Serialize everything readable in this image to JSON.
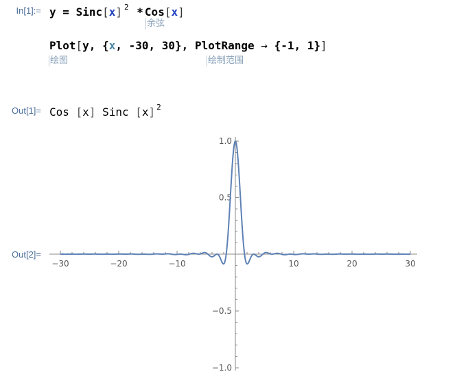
{
  "cells": {
    "in1_label": "In[1]:=",
    "line1": {
      "y": "y",
      "eq": "=",
      "sinc": "Sinc",
      "x1": "x",
      "pow": "2",
      "star": "*",
      "cos": "Cos",
      "x2": "x"
    },
    "hint_cos": "余弦",
    "line2": {
      "plot": "Plot",
      "open": "[",
      "y": "y, {",
      "x": "x",
      "range": ", -30, 30}, ",
      "plotrange": "PlotRange",
      "arrow": "→",
      "pr_value": "{-1, 1}",
      "close": "]"
    },
    "hint_plot": "绘图",
    "hint_plotrange": "绘制范围",
    "out1_label": "Out[1]=",
    "out1": {
      "cos": "Cos",
      "x1": "x",
      "sinc": "Sinc",
      "x2": "x",
      "pow": "2"
    },
    "out2_label": "Out[2]="
  },
  "chart_data": {
    "type": "line",
    "function": "Cos[x] Sinc[x]^2",
    "xlim": [
      -30,
      30
    ],
    "ylim": [
      -1,
      1
    ],
    "x_ticks": [
      "-30",
      "-20",
      "-10",
      "10",
      "20",
      "30"
    ],
    "x_tick_values": [
      -30,
      -20,
      -10,
      10,
      20,
      30
    ],
    "y_ticks": [
      "1.0",
      "0.5",
      "-0.5",
      "-1.0"
    ],
    "y_tick_values": [
      1.0,
      0.5,
      -0.5,
      -1.0
    ],
    "line_color": "#5e81b5",
    "axis_color": "#888888",
    "grid": false
  }
}
